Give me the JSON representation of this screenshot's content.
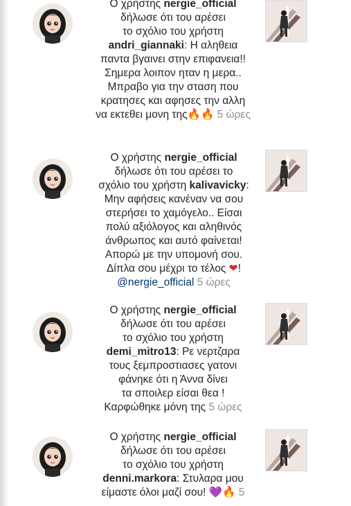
{
  "notifications": [
    {
      "lines": [
        "Ο χρήστης",
        "δήλωσε ότι του αρέσει",
        "το σχόλιο του χρήστη"
      ],
      "username": "nergie_official",
      "commenter": "andri_giannaki",
      "comment_lines": [
        "Η αληθεια",
        "παντα βγαινει στην επιφανεια!!",
        "Σημερα λοιπον ηταν η μερα..",
        "Μπραβο για την σταση που",
        "κρατησες και αφησες την αλλη",
        "να εκτεθει μονη της"
      ],
      "emoji": "🔥🔥",
      "time": "5 ώρες"
    },
    {
      "lines": [
        "Ο χρήστης",
        "δήλωσε ότι του αρέσει το",
        "σχόλιο του χρήστη"
      ],
      "username": "nergie_official",
      "commenter": "kalivavicky",
      "comment_lines": [
        "Μην αφήσεις κανέναν να σου",
        "στερήσει το χαμόγελο.. Είσαι",
        "πολύ αξιόλογος και αληθινός",
        "άνθρωπος και αυτό φαίνεται!",
        "Απορώ με την υπομονή σου.",
        "Δίπλα σου μέχρι το τέλος"
      ],
      "emoji": "❤",
      "mention": "@nergie_official",
      "time": "5 ώρες"
    },
    {
      "lines": [
        "Ο χρήστης",
        "δήλωσε ότι του αρέσει",
        "το σχόλιο του χρήστη"
      ],
      "username": "nergie_official",
      "commenter": "demi_mitro13",
      "comment_lines": [
        "Ρε νερτζαρα",
        "τους ξεμπροστιασες γατονι",
        "φάνηκε ότι η Άννα δίνει",
        "τα σποιλερ είσαι θεα !",
        "Καρφώθηκε μόνη της"
      ],
      "time": "5 ώρες"
    },
    {
      "lines": [
        "Ο χρήστης",
        "δήλωσε ότι του αρέσει",
        "το σχόλιο του χρήστη"
      ],
      "username": "nergie_official",
      "commenter": "denni.markora",
      "comment_lines": [
        "Στυλαρα μου",
        "είμαστε όλοι μαζί σου!"
      ],
      "emoji": "💜🔥",
      "time": "5"
    }
  ]
}
